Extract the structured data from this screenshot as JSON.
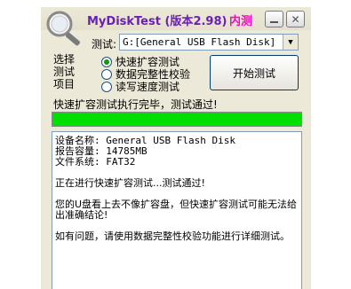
{
  "window": {
    "app_name": "MyDiskTest",
    "version_label": "(版本",
    "version": "2.98",
    "version_close": ")",
    "tag": "内测"
  },
  "drive": {
    "label": "测试:",
    "selected": "G:[General USB Flash Disk]"
  },
  "options": {
    "side_labels": [
      "选择",
      "测试",
      "项目"
    ],
    "items": [
      {
        "label": "快速扩容测试",
        "selected": true
      },
      {
        "label": "数据完整性校验",
        "selected": false
      },
      {
        "label": "读写速度测试",
        "selected": false
      }
    ]
  },
  "start_button": "开始测试",
  "status": "快速扩容测试执行完毕，测试通过!",
  "progress": {
    "value": 100,
    "color": "#00e000"
  },
  "log": {
    "info": [
      "设备名称: General USB Flash Disk",
      "报告容量: 14785MB",
      "文件系统: FAT32"
    ],
    "running": "正在进行快速扩容测试...测试通过!",
    "note": "您的U盘看上去不像扩容盘，但快速扩容测试可能无法给出准确结论!",
    "tip": "如有问题，请使用数据完整性校验功能进行详细测试。"
  }
}
